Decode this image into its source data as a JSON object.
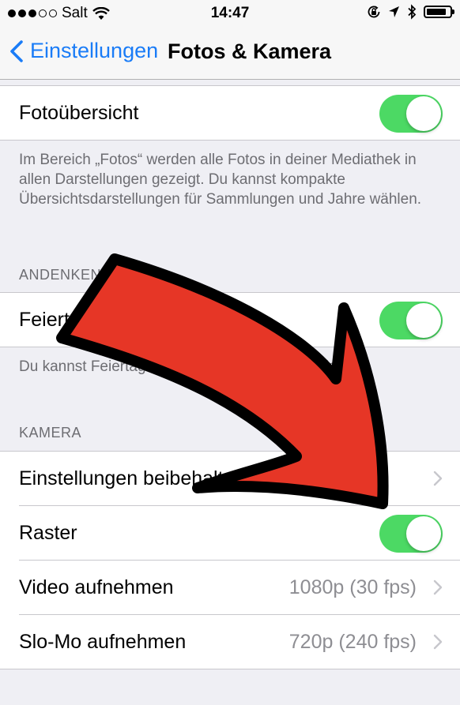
{
  "status_bar": {
    "carrier": "Salt",
    "time": "14:47",
    "signal_bars_filled": 3,
    "signal_bars_total": 5,
    "battery_level": 0.85,
    "icons": [
      "wifi-icon",
      "rotation-lock-icon",
      "location-icon",
      "bluetooth-icon",
      "battery-icon"
    ]
  },
  "nav": {
    "back_label": "Einstellungen",
    "title": "Fotos & Kamera"
  },
  "foto_overview": {
    "label": "Fotoübersicht",
    "enabled": true,
    "footnote": "Im Bereich „Fotos“ werden alle Fotos in deiner Mediathek in allen Darstellungen gezeigt. Du kannst kompakte Übersichtsdarstellungen für Sammlungen und Jahre wählen."
  },
  "memories": {
    "header": "ANDENKEN",
    "label": "Feiertage anzeigen",
    "enabled": true,
    "footnote": "Du kannst Feiertage deines Landes anzeigen lassen."
  },
  "camera": {
    "header": "KAMERA",
    "rows": [
      {
        "label": "Einstellungen beibehalten",
        "value": "",
        "type": "chevron"
      },
      {
        "label": "Raster",
        "value": "",
        "type": "toggle",
        "enabled": true
      },
      {
        "label": "Video aufnehmen",
        "value": "1080p (30 fps)",
        "type": "chevron"
      },
      {
        "label": "Slo-Mo aufnehmen",
        "value": "720p (240 fps)",
        "type": "chevron"
      }
    ]
  },
  "colors": {
    "tint": "#1a7cf7",
    "toggle_on": "#4cd964",
    "arrow_fill": "#e63626",
    "arrow_outline": "#000000"
  }
}
